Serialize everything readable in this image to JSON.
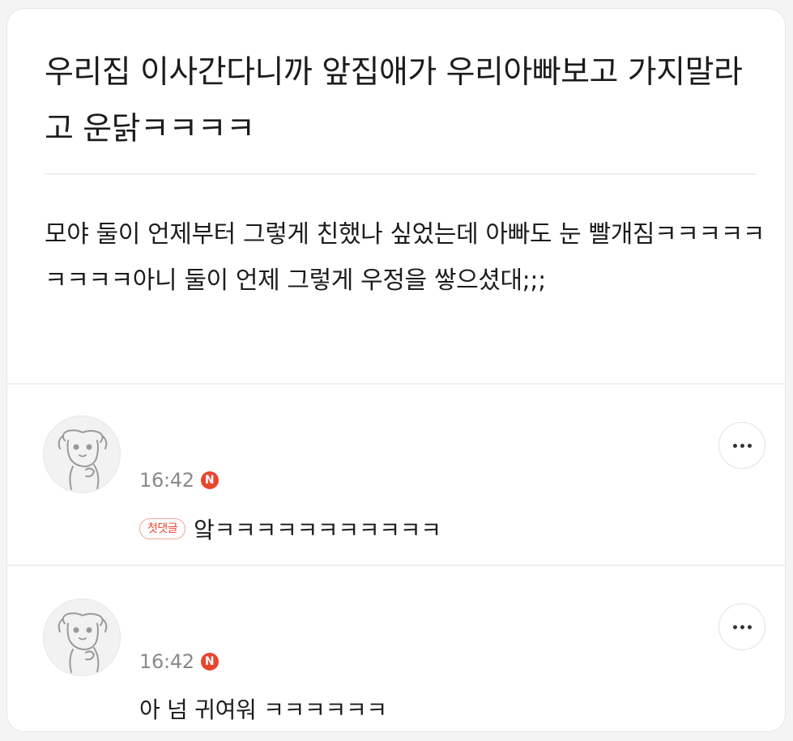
{
  "post": {
    "title": "우리집 이사간다니까 앞집애가 우리아빠보고 가지말라고 운닭ㅋㅋㅋㅋ",
    "body": "모야 둘이 언제부터 그렇게 친했나 싶었는데 아빠도 눈 빨개짐ㅋㅋㅋㅋㅋㅋㅋㅋㅋ아니 둘이 언제 그렇게 우정을 쌓으셨대;;;"
  },
  "comments": [
    {
      "time": "16:42",
      "badge": "N",
      "first_comment_label": "첫댓글",
      "text": "앜ㅋㅋㅋㅋㅋㅋㅋㅋㅋㅋㅋ",
      "more_icon": "more-horizontal-icon"
    },
    {
      "time": "16:42",
      "badge": "N",
      "text": "아 넘 귀여워 ㅋㅋㅋㅋㅋㅋ",
      "more_icon": "more-horizontal-icon"
    }
  ],
  "colors": {
    "accent": "#e8452f",
    "time": "#8a8a8a",
    "text": "#1c1c1c"
  }
}
